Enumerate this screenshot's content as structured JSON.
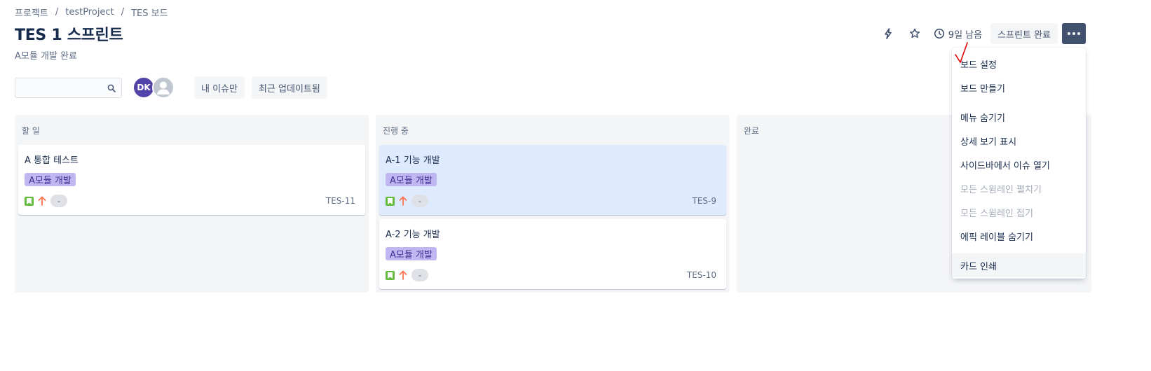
{
  "breadcrumb": {
    "items": [
      "프로젝트",
      "testProject",
      "TES 보드"
    ],
    "separator": "/"
  },
  "header": {
    "title": "TES 1 스프린트",
    "sprint_goal": "A모듈 개발 완료",
    "days_left": "9일 남음",
    "complete_sprint_label": "스프린트 완료",
    "icons": [
      "automation-icon",
      "star-icon",
      "clock-icon",
      "share-icon",
      "more-icon"
    ]
  },
  "filters": {
    "search_value": "",
    "search_placeholder": "",
    "avatars": [
      {
        "initials": "DK",
        "color": "#5243aa"
      },
      {
        "initials": "",
        "color": "#c1c7d0"
      }
    ],
    "quick_filters": [
      "내 이슈만",
      "최근 업데이트됨"
    ]
  },
  "columns": [
    {
      "name": "할 일",
      "cards": [
        {
          "title": "A 통합 테스트",
          "epic": "A모듈 개발",
          "estimate": "-",
          "key": "TES-11",
          "selected": false
        }
      ]
    },
    {
      "name": "진행 중",
      "cards": [
        {
          "title": "A-1 기능 개발",
          "epic": "A모듈 개발",
          "estimate": "-",
          "key": "TES-9",
          "selected": true
        },
        {
          "title": "A-2 기능 개발",
          "epic": "A모듈 개발",
          "estimate": "-",
          "key": "TES-10",
          "selected": false
        }
      ]
    },
    {
      "name": "완료",
      "cards": []
    }
  ],
  "menu": {
    "items": [
      {
        "label": "보드 설정",
        "disabled": false
      },
      {
        "label": "보드 만들기",
        "disabled": false
      },
      {
        "label": "메뉴 숨기기",
        "disabled": false
      },
      {
        "label": "상세 보기 표시",
        "disabled": false
      },
      {
        "label": "사이드바에서 이슈 열기",
        "disabled": false
      },
      {
        "label": "모든 스윔레인 펼치기",
        "disabled": true
      },
      {
        "label": "모든 스윔레인 접기",
        "disabled": true
      },
      {
        "label": "에픽 레이블 숨기기",
        "disabled": false
      },
      {
        "label": "카드 인쇄",
        "disabled": false
      }
    ]
  },
  "colors": {
    "epic_bg": "#c0b6f2",
    "epic_text": "#403294",
    "story": "#63ba3c",
    "priority_high": "#ff7452",
    "selected_card": "#deebff",
    "primary_dark": "#42526e",
    "annotation_mark": "#e00000"
  }
}
